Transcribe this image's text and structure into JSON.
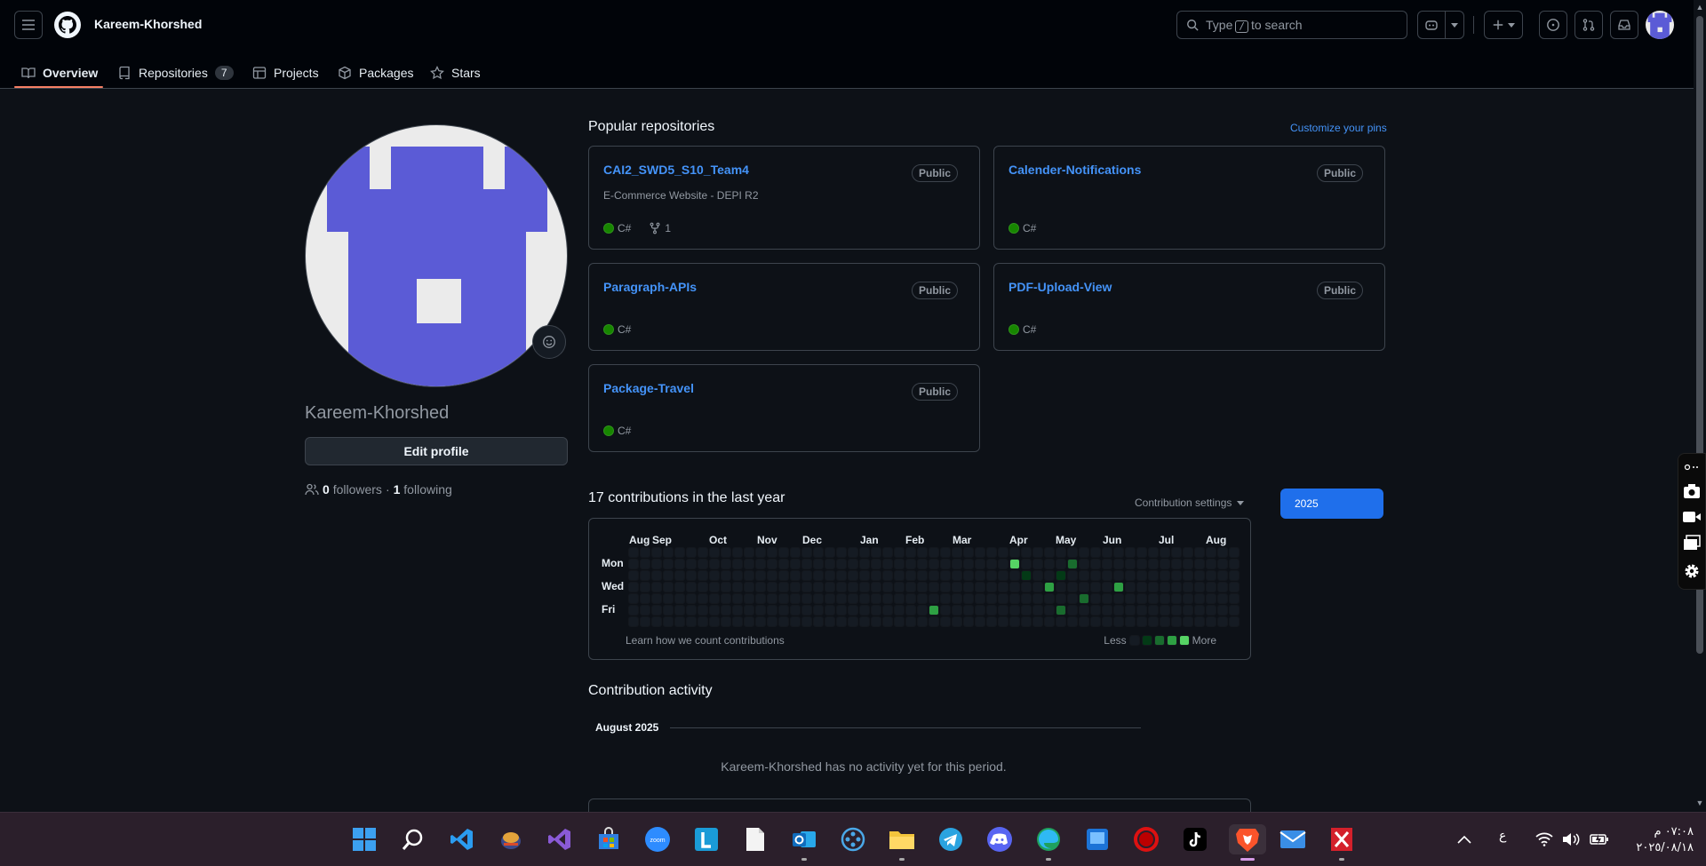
{
  "header": {
    "username": "Kareem-Khorshed",
    "search_prefix": "Type",
    "search_key": "/",
    "search_suffix": "to search"
  },
  "nav": {
    "overview": "Overview",
    "repositories": "Repositories",
    "repositories_count": "7",
    "projects": "Projects",
    "packages": "Packages",
    "stars": "Stars"
  },
  "profile": {
    "name": "Kareem-Khorshed",
    "edit_label": "Edit profile",
    "followers_count": "0",
    "followers_label": "followers",
    "separator": "·",
    "following_count": "1",
    "following_label": "following"
  },
  "pinned": {
    "title": "Popular repositories",
    "customize": "Customize your pins",
    "repos": [
      {
        "name": "CAI2_SWD5_S10_Team4",
        "visibility": "Public",
        "description": "E-Commerce Website - DEPI R2",
        "language": "C#",
        "forks": "1"
      },
      {
        "name": "Calender-Notifications",
        "visibility": "Public",
        "description": "",
        "language": "C#"
      },
      {
        "name": "Paragraph-APIs",
        "visibility": "Public",
        "description": "",
        "language": "C#"
      },
      {
        "name": "PDF-Upload-View",
        "visibility": "Public",
        "description": "",
        "language": "C#"
      },
      {
        "name": "Package-Travel",
        "visibility": "Public",
        "description": "",
        "language": "C#"
      }
    ],
    "language_color": "#178600"
  },
  "contributions": {
    "title": "17 contributions in the last year",
    "settings": "Contribution settings",
    "year": "2025",
    "months": [
      "Aug",
      "Sep",
      "Oct",
      "Nov",
      "Dec",
      "Jan",
      "Feb",
      "Mar",
      "Apr",
      "May",
      "Jun",
      "Jul",
      "Aug"
    ],
    "days": [
      "Mon",
      "Wed",
      "Fri"
    ],
    "learn": "Learn how we count contributions",
    "less": "Less",
    "more": "More",
    "colors": [
      "#151b23",
      "#033a16",
      "#196c2e",
      "#2ea043",
      "#56d364"
    ]
  },
  "activity": {
    "title": "Contribution activity",
    "month": "August 2025",
    "empty": "Kareem-Khorshed has no activity yet for this period."
  },
  "taskbar": {
    "clock_time": "٠٧:٠٨ م",
    "clock_date": "٢٠٢٥/٠٨/١٨",
    "lang": "ع"
  }
}
